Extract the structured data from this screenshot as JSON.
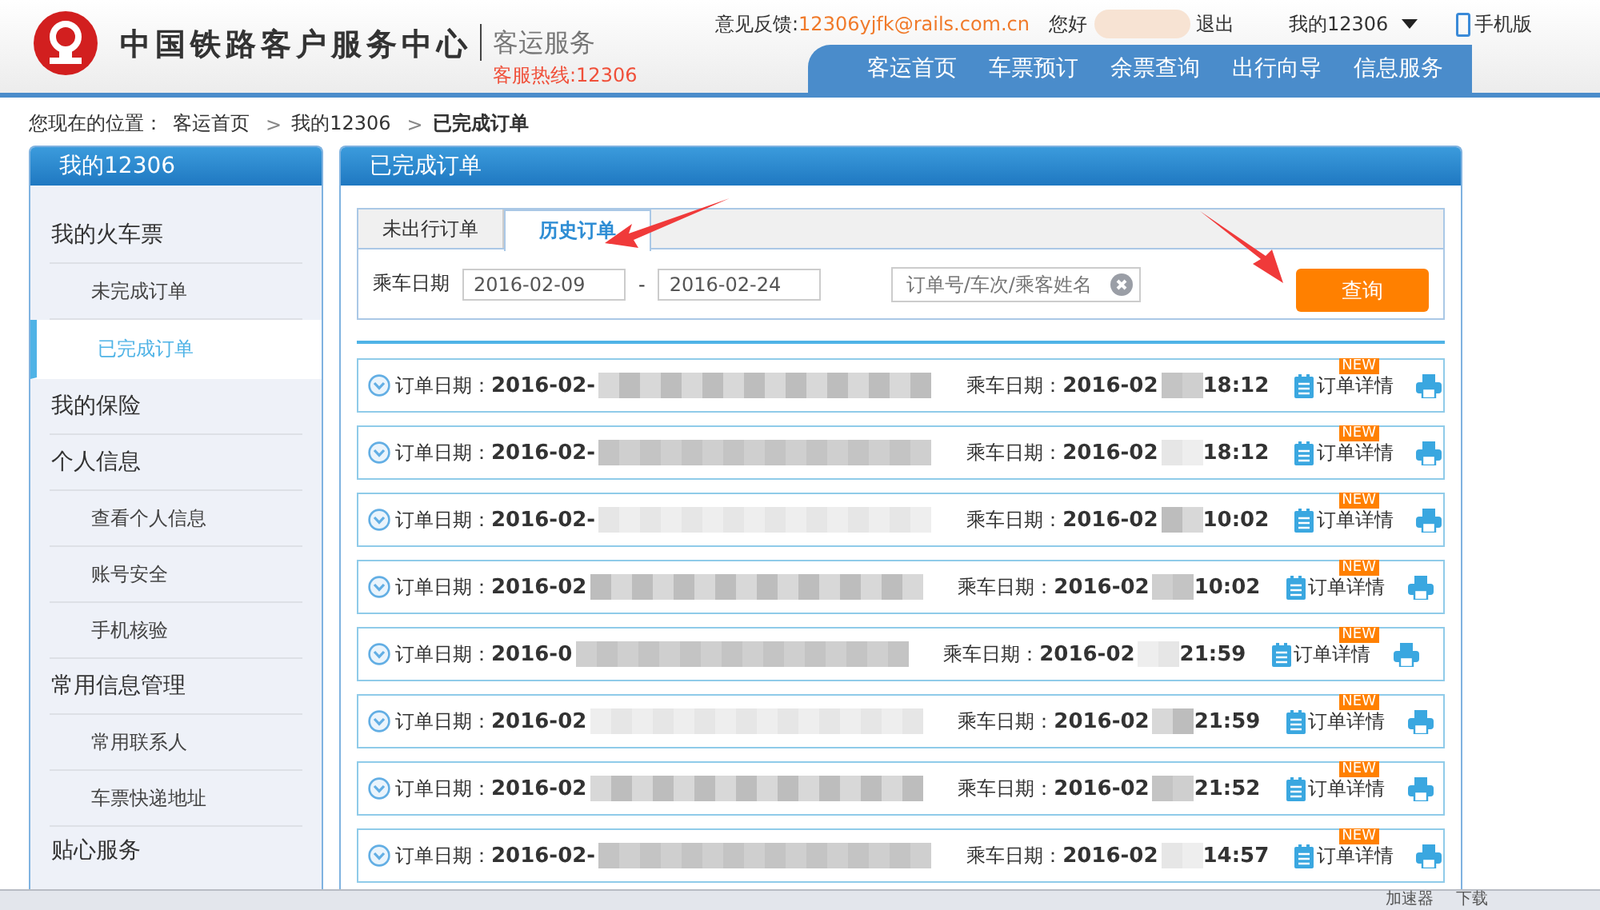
{
  "header": {
    "title": "中国铁路客户服务中心",
    "subtitle": "客运服务",
    "hotline": "客服热线:12306",
    "feedback_label": "意见反馈:",
    "feedback_email": "12306yjfk@rails.com.cn",
    "greeting": "您好",
    "logout": "退出",
    "account_menu": "我的12306",
    "mobile": "手机版"
  },
  "nav": [
    {
      "label": "客运首页"
    },
    {
      "label": "车票预订"
    },
    {
      "label": "余票查询"
    },
    {
      "label": "出行向导"
    },
    {
      "label": "信息服务"
    }
  ],
  "breadcrumb": {
    "prefix": "您现在的位置：",
    "items": [
      {
        "label": "客运首页",
        "current": false
      },
      {
        "separator": ">",
        "label": "我的12306",
        "current": false
      },
      {
        "separator": ">",
        "label": "已完成订单",
        "current": true
      }
    ]
  },
  "sidebar": {
    "title": "我的12306",
    "items": [
      {
        "label": "我的火车票",
        "kind": "group",
        "selected": false
      },
      {
        "label": "未完成订单",
        "kind": "sub",
        "selected": false
      },
      {
        "label": "已完成订单",
        "kind": "sub",
        "selected": true
      },
      {
        "label": "我的保险",
        "kind": "group",
        "selected": false
      },
      {
        "label": "个人信息",
        "kind": "group",
        "selected": false
      },
      {
        "label": "查看个人信息",
        "kind": "sub",
        "selected": false
      },
      {
        "label": "账号安全",
        "kind": "sub",
        "selected": false
      },
      {
        "label": "手机核验",
        "kind": "sub",
        "selected": false
      },
      {
        "label": "常用信息管理",
        "kind": "group",
        "selected": false
      },
      {
        "label": "常用联系人",
        "kind": "sub",
        "selected": false
      },
      {
        "label": "车票快递地址",
        "kind": "sub",
        "selected": false
      },
      {
        "label": "贴心服务",
        "kind": "group",
        "selected": false
      }
    ]
  },
  "panel": {
    "title": "已完成订单",
    "tabs": [
      {
        "label": "未出行订单",
        "selected": false
      },
      {
        "label": "历史订单",
        "selected": true
      }
    ],
    "filter": {
      "label": "乘车日期",
      "from": "2016-02-09",
      "dash": "-",
      "to": "2016-02-24",
      "search_placeholder": "订单号/车次/乘客姓名",
      "button": "查询"
    }
  },
  "orders": [
    {
      "order_label": "订单日期：",
      "order_date": "2016-02-",
      "ride_label": "乘车日期：",
      "ride_date": "2016-02",
      "ride_time": "18:12",
      "details": "订单详情",
      "badge": "NEW"
    },
    {
      "order_label": "订单日期：",
      "order_date": "2016-02-",
      "ride_label": "乘车日期：",
      "ride_date": "2016-02",
      "ride_time": "18:12",
      "details": "订单详情",
      "badge": "NEW"
    },
    {
      "order_label": "订单日期：",
      "order_date": "2016-02-",
      "ride_label": "乘车日期：",
      "ride_date": "2016-02",
      "ride_time": "10:02",
      "details": "订单详情",
      "badge": "NEW"
    },
    {
      "order_label": "订单日期：",
      "order_date": "2016-02",
      "ride_label": "乘车日期：",
      "ride_date": "2016-02",
      "ride_time": "10:02",
      "details": "订单详情",
      "badge": "NEW"
    },
    {
      "order_label": "订单日期：",
      "order_date": "2016-0",
      "ride_label": "乘车日期：",
      "ride_date": "2016-02",
      "ride_time": "21:59",
      "details": "订单详情",
      "badge": "NEW"
    },
    {
      "order_label": "订单日期：",
      "order_date": "2016-02",
      "ride_label": "乘车日期：",
      "ride_date": "2016-02",
      "ride_time": "21:59",
      "details": "订单详情",
      "badge": "NEW"
    },
    {
      "order_label": "订单日期：",
      "order_date": "2016-02",
      "ride_label": "乘车日期：",
      "ride_date": "2016-02",
      "ride_time": "21:52",
      "details": "订单详情",
      "badge": "NEW"
    },
    {
      "order_label": "订单日期：",
      "order_date": "2016-02-",
      "ride_label": "乘车日期：",
      "ride_date": "2016-02",
      "ride_time": "14:57",
      "details": "订单详情",
      "badge": "NEW"
    }
  ],
  "status_bar": {
    "items": [
      {
        "label": "加速器"
      },
      {
        "label": "下载"
      }
    ]
  }
}
